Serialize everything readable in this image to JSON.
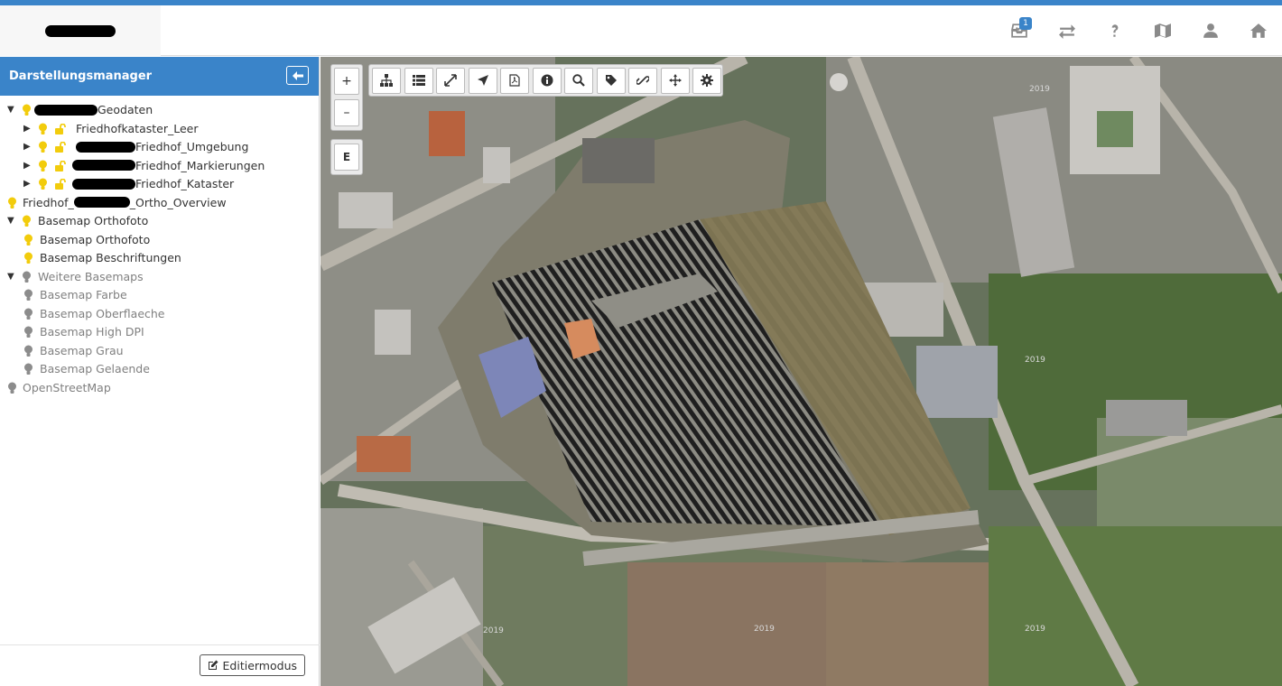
{
  "header": {
    "icons": [
      {
        "name": "inbox-icon",
        "badge": "1"
      },
      {
        "name": "swap-icon"
      },
      {
        "name": "help-icon"
      },
      {
        "name": "map-icon"
      },
      {
        "name": "user-icon"
      },
      {
        "name": "home-icon"
      }
    ]
  },
  "sidebar": {
    "title": "Darstellungsmanager",
    "layers": [
      {
        "label": "Geodaten",
        "toggle": "▼",
        "bulb": "yellow"
      },
      {
        "label": "Friedhofkataster_Leer",
        "toggle": "▶",
        "bulb": "yellow",
        "lock": true
      },
      {
        "label": "Friedhof_Umgebung",
        "toggle": "▶",
        "bulb": "yellow",
        "lock": true
      },
      {
        "label": "Friedhof_Markierungen",
        "toggle": "▶",
        "bulb": "yellow",
        "lock": true
      },
      {
        "label": "Friedhof_Kataster",
        "toggle": "▶",
        "bulb": "yellow",
        "lock": true
      },
      {
        "label_pre": "Friedhof_",
        "label_post": "_Ortho_Overview",
        "bulb": "yellow"
      },
      {
        "label": "Basemap Orthofoto",
        "toggle": "▼",
        "bulb": "yellow"
      },
      {
        "label": "Basemap Orthofoto",
        "bulb": "yellow"
      },
      {
        "label": "Basemap Beschriftungen",
        "bulb": "yellow"
      },
      {
        "label": "Weitere Basemaps",
        "toggle": "▼",
        "bulb": "grey"
      },
      {
        "label": "Basemap Farbe",
        "bulb": "grey"
      },
      {
        "label": "Basemap Oberflaeche",
        "bulb": "grey"
      },
      {
        "label": "Basemap High DPI",
        "bulb": "grey"
      },
      {
        "label": "Basemap Grau",
        "bulb": "grey"
      },
      {
        "label": "Basemap Gelaende",
        "bulb": "grey"
      },
      {
        "label": "OpenStreetMap",
        "bulb": "grey"
      }
    ],
    "edit_button": "Editiermodus"
  },
  "map": {
    "zoom_in": "+",
    "zoom_out": "–",
    "edit_mode_button": "E",
    "imagery_year_labels": [
      "2019",
      "2019",
      "2019",
      "2019",
      "2019"
    ],
    "toolbar": [
      "tree-icon",
      "list-icon",
      "expand-icon",
      "locate-icon",
      "pdf-icon",
      "info-icon",
      "search-icon",
      "tag-icon",
      "link-icon",
      "move-icon",
      "gear-icon"
    ]
  }
}
